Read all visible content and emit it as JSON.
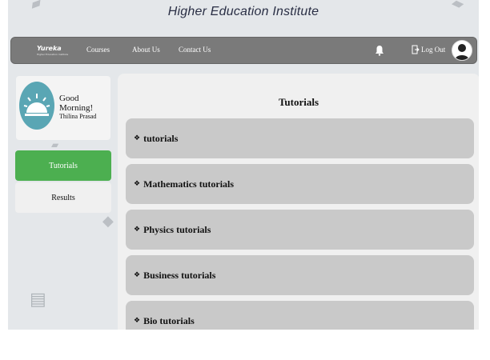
{
  "site": {
    "title": "Higher Education Institute"
  },
  "nav": {
    "brand": "Yureka",
    "brand_sub": "Higher Education Institute",
    "links": [
      "Courses",
      "About Us",
      "Contact Us"
    ],
    "logout": "Log Out"
  },
  "sidebar": {
    "greeting": "Good Morning!",
    "user": "Thilina Prasad",
    "items": [
      {
        "label": "Tutorials",
        "active": true
      },
      {
        "label": "Results",
        "active": false
      }
    ]
  },
  "main": {
    "title": "Tutorials",
    "items": [
      "tutorials",
      "Mathematics tutorials",
      "Physics tutorials",
      "Business tutorials",
      "Bio tutorials"
    ]
  },
  "colors": {
    "navbar": "#7a7a7a",
    "active": "#4caf50",
    "item_bg": "#c9c9c9",
    "avatar_bg": "#5aa6b4"
  }
}
